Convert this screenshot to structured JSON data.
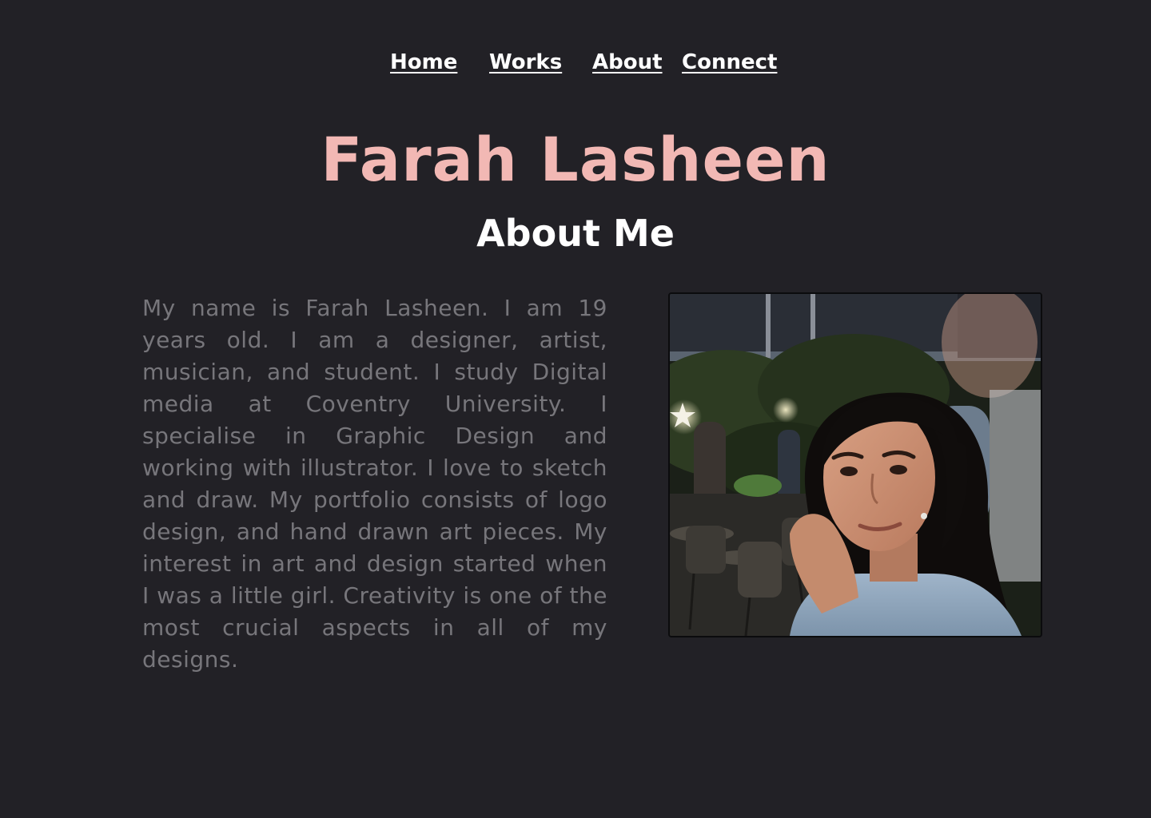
{
  "nav": {
    "home": "Home",
    "works": "Works",
    "about": "About",
    "connect": "Connect"
  },
  "header": {
    "title": "Farah Lasheen",
    "subtitle": "About Me"
  },
  "bio": {
    "text": "My name is Farah Lasheen. I am 19 years old. I am a designer, artist, musician, and student. I study Digital media at Coventry University. I specialise in Graphic Design and working with illustrator. I love to sketch and draw. My portfolio consists of logo design, and hand drawn art pieces. My interest in art and design started when I was a little girl. Creativity is one of the most crucial aspects in all of my designs."
  },
  "colors": {
    "background": "#222126",
    "accent": "#f2b8b4",
    "body_text": "#77767b"
  }
}
